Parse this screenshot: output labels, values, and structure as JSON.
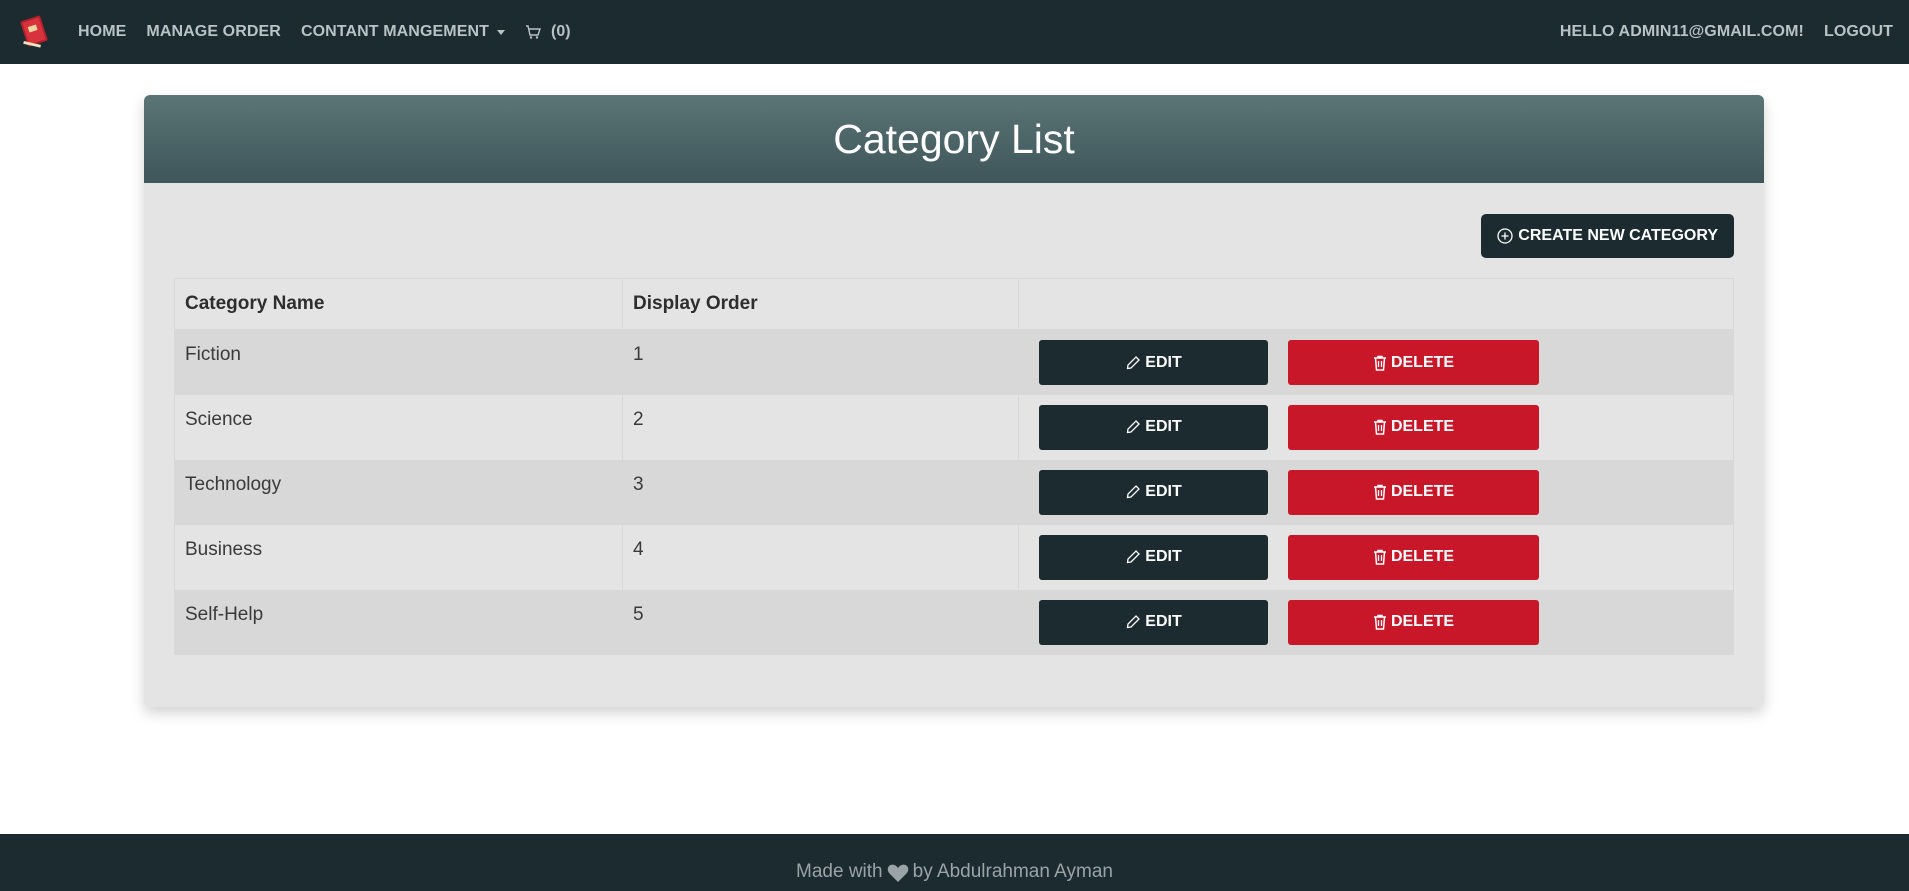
{
  "navbar": {
    "brand_icon": "book-logo-icon",
    "links": [
      "HOME",
      "MANAGE ORDER"
    ],
    "dropdown_label": "CONTANT MANGEMENT",
    "cart_icon": "cart-icon",
    "cart_count": "(0)",
    "greeting": "HELLO ADMIN11@GMAIL.COM!",
    "logout": "LOGOUT"
  },
  "page": {
    "title": "Category List",
    "create_button": "CREATE NEW CATEGORY"
  },
  "table": {
    "headers": [
      "Category Name",
      "Display Order",
      ""
    ],
    "rows": [
      {
        "name": "Fiction",
        "order": "1"
      },
      {
        "name": "Science",
        "order": "2"
      },
      {
        "name": "Technology",
        "order": "3"
      },
      {
        "name": "Business",
        "order": "4"
      },
      {
        "name": "Self-Help",
        "order": "5"
      }
    ],
    "edit_label": "EDIT",
    "delete_label": "DELETE"
  },
  "footer": {
    "made_with": "Made with",
    "heart_icon": "heart-icon",
    "by": "by Abdulrahman Ayman"
  },
  "colors": {
    "dark": "#1b2b30",
    "danger": "#c9172a",
    "header_gradient_top": "#5b7476",
    "header_gradient_bottom": "#3e5659"
  }
}
